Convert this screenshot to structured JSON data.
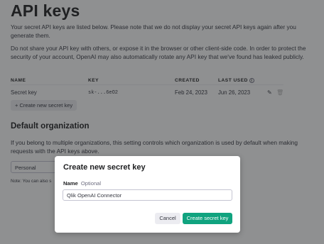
{
  "page": {
    "title": "API keys",
    "intro": "Your secret API keys are listed below. Please note that we do not display your secret API keys again after you generate them.",
    "warning": "Do not share your API key with others, or expose it in the browser or other client-side code. In order to protect the security of your account, OpenAI may also automatically rotate any API key that we've found has leaked publicly."
  },
  "table": {
    "headers": {
      "name": "NAME",
      "key": "KEY",
      "created": "CREATED",
      "last_used": "LAST USED"
    },
    "rows": [
      {
        "name": "Secret key",
        "key": "sk-...6eO2",
        "created": "Feb 24, 2023",
        "last_used": "Jun 26, 2023"
      }
    ],
    "create_button": "+ Create new secret key"
  },
  "org": {
    "heading": "Default organization",
    "description": "If you belong to multiple organizations, this setting controls which organization is used by default when making requests with the API keys above.",
    "selected": "Personal",
    "note": "Note: You can also s"
  },
  "modal": {
    "title": "Create new secret key",
    "name_label": "Name",
    "optional_label": "Optional",
    "name_value": "Qlik OpenAI Connector",
    "cancel": "Cancel",
    "create": "Create secret key"
  },
  "colors": {
    "accent": "#10a37f",
    "overlay": "#202123"
  },
  "icons": {
    "info": "info-icon",
    "edit": "pencil-icon",
    "delete": "trash-icon"
  }
}
